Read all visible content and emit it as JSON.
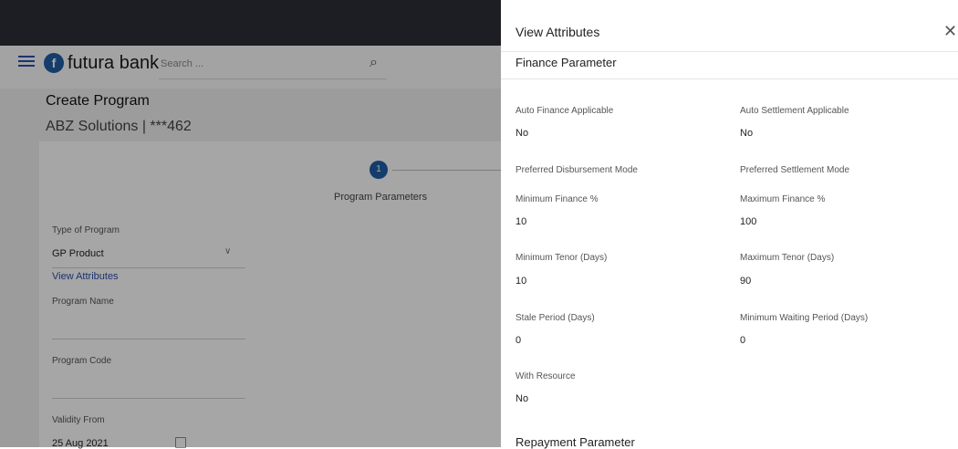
{
  "header": {
    "logo_text": "futura bank",
    "search_placeholder": "Search ..."
  },
  "page": {
    "title": "Create Program",
    "subtitle": "ABZ Solutions | ***462"
  },
  "stepper": {
    "step_number": "1",
    "step_label": "Program Parameters"
  },
  "form": {
    "type_label": "Type of Program",
    "type_value": "GP Product",
    "view_attributes_link": "View Attributes",
    "program_name_label": "Program Name",
    "program_code_label": "Program Code",
    "validity_from_label": "Validity From",
    "validity_from_value": "25 Aug 2021"
  },
  "panel": {
    "title": "View Attributes",
    "section_title": "Finance Parameter",
    "next_section_title": "Repayment Parameter",
    "auto_finance_label": "Auto Finance Applicable",
    "auto_finance_value": "No",
    "auto_settlement_label": "Auto Settlement Applicable",
    "auto_settlement_value": "No",
    "pref_disb_label": "Preferred Disbursement Mode",
    "pref_settle_label": "Preferred Settlement Mode",
    "min_finance_label": "Minimum Finance %",
    "min_finance_value": "10",
    "max_finance_label": "Maximum Finance %",
    "max_finance_value": "100",
    "min_tenor_label": "Minimum Tenor (Days)",
    "min_tenor_value": "10",
    "max_tenor_label": "Maximum Tenor (Days)",
    "max_tenor_value": "90",
    "stale_label": "Stale Period (Days)",
    "stale_value": "0",
    "min_wait_label": "Minimum Waiting Period (Days)",
    "min_wait_value": "0",
    "with_resource_label": "With Resource",
    "with_resource_value": "No"
  }
}
